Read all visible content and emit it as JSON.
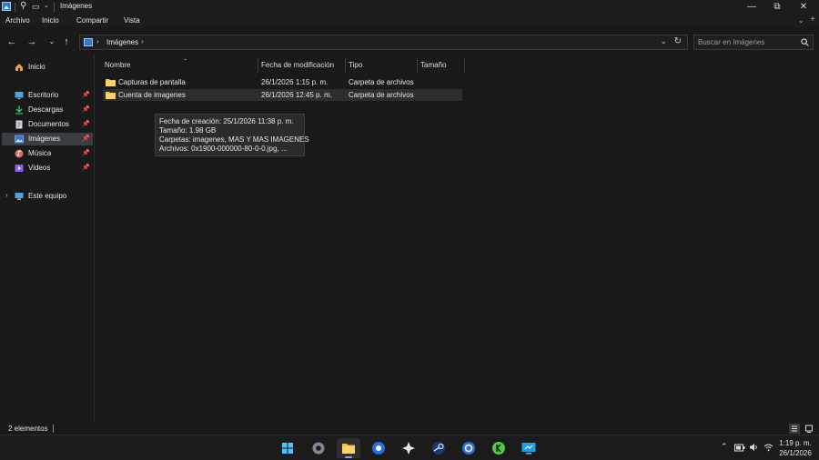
{
  "window": {
    "title": "Imágenes",
    "controls": {
      "minimize": "—",
      "maximize": "⧉",
      "close": "✕"
    }
  },
  "ribbon": {
    "menu": [
      "Archivo",
      "Inicio",
      "Compartir",
      "Vista"
    ]
  },
  "nav": {
    "address": {
      "icon": "pictures-folder-icon",
      "path": [
        "Imágenes"
      ]
    },
    "search_placeholder": "Buscar en Imágenes"
  },
  "sidebar": {
    "items": [
      {
        "label": "Inicio",
        "icon": "home-icon",
        "pinned": false
      },
      {
        "label": "Escritorio",
        "icon": "desktop-icon",
        "pinned": true
      },
      {
        "label": "Descargas",
        "icon": "download-icon",
        "pinned": true
      },
      {
        "label": "Documentos",
        "icon": "documents-icon",
        "pinned": true
      },
      {
        "label": "Imágenes",
        "icon": "pictures-icon",
        "pinned": true,
        "selected": true
      },
      {
        "label": "Música",
        "icon": "music-icon",
        "pinned": true
      },
      {
        "label": "Videos",
        "icon": "videos-icon",
        "pinned": true
      },
      {
        "label": "Este equipo",
        "icon": "this-pc-icon",
        "pinned": false
      }
    ]
  },
  "list": {
    "columns": [
      "Nombre",
      "Fecha de modificación",
      "Tipo",
      "Tamaño"
    ],
    "rows": [
      {
        "name": "Capturas de pantalla",
        "modified": "26/1/2026 1:15 p. m.",
        "type": "Carpeta de archivos",
        "size": ""
      },
      {
        "name": "Cuenta de imagenes",
        "modified": "26/1/2026 12:45 p. m.",
        "type": "Carpeta de archivos",
        "size": ""
      }
    ]
  },
  "tooltip": {
    "lines": [
      "Fecha de creación: 25/1/2026 11:38 p. m.",
      "Tamaño: 1.98 GB",
      "Carpetas: imagenes, MAS Y MAS IMAGENES",
      "Archivos: 0x1900-000000-80-0-0.jpg, ..."
    ]
  },
  "status": {
    "count": "2 elementos"
  },
  "taskbar": {
    "apps": [
      "start-icon",
      "settings-icon",
      "file-explorer-icon",
      "browser-icon",
      "game-app-icon",
      "steam-icon",
      "gear-app-icon",
      "k-app-icon",
      "remote-desktop-icon"
    ],
    "tray_icons": [
      "chevron-up-icon",
      "battery-icon",
      "volume-icon",
      "wifi-icon"
    ],
    "time": "1:19 p. m.",
    "date": "26/1/2026"
  },
  "colors": {
    "background": "#191919",
    "folder": "#f2c14e",
    "accent": "#2f7bd1",
    "selection": "#3a3d41"
  }
}
